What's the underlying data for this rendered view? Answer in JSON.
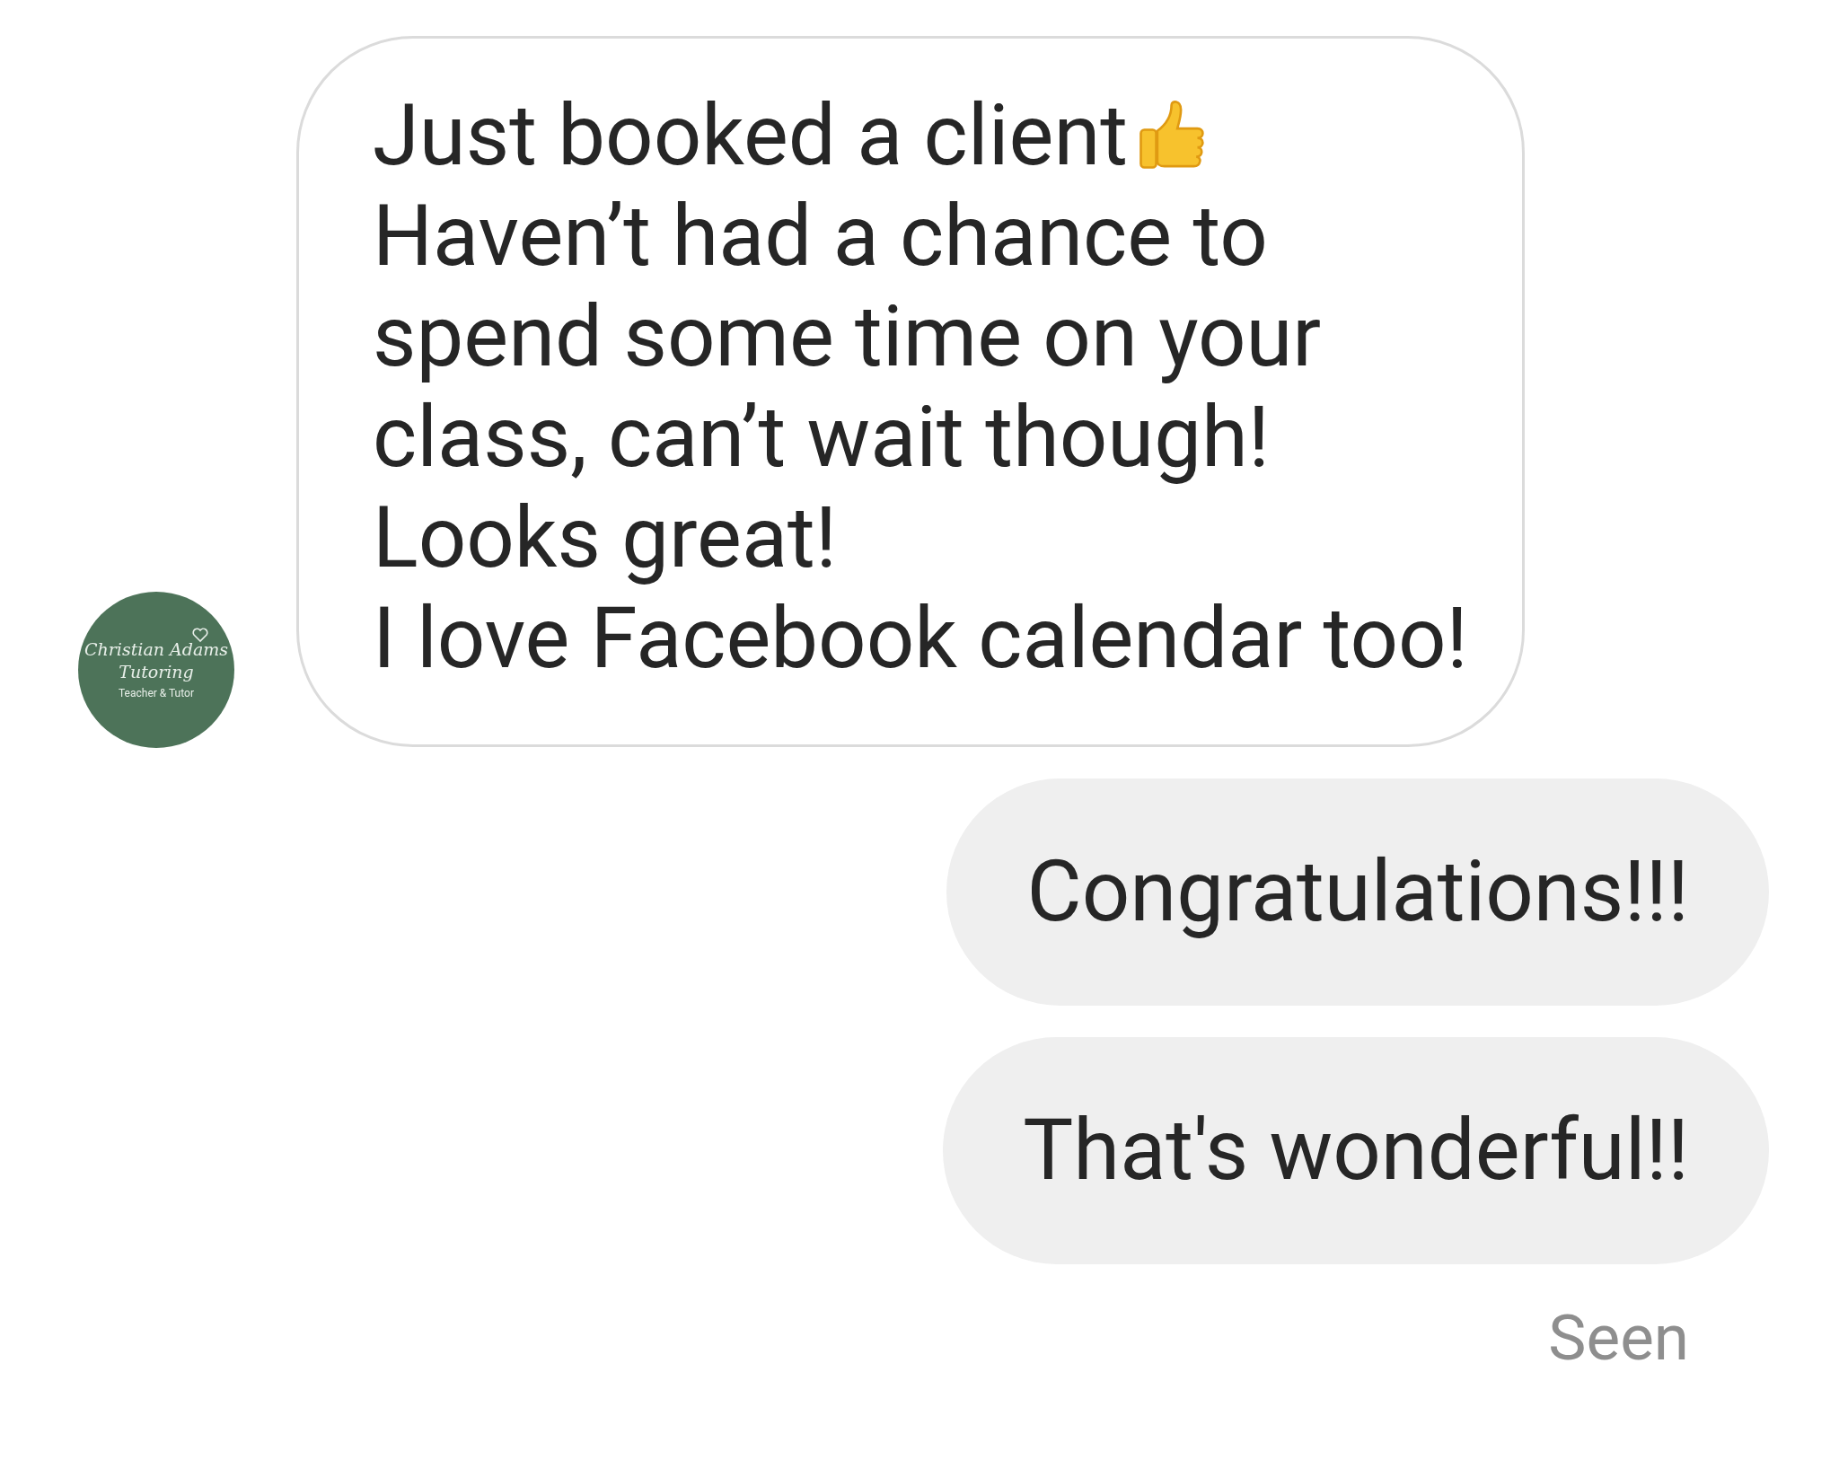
{
  "incoming": {
    "avatar": {
      "kind": "logo",
      "title": "Christian Adams",
      "subtitle": "Tutoring",
      "tagline": "Teacher & Tutor"
    },
    "lines": [
      {
        "text": "Just booked a client",
        "thumbs_up": true
      },
      {
        "text": "Haven’t had a chance to"
      },
      {
        "text": "spend some time on your"
      },
      {
        "text": "class, can’t wait though!"
      },
      {
        "text": "Looks great!"
      },
      {
        "text": "I love Facebook calendar too!"
      }
    ]
  },
  "outgoing": [
    {
      "text": "Congratulations!!!"
    },
    {
      "text": "That's wonderful!!"
    }
  ],
  "status": "Seen"
}
